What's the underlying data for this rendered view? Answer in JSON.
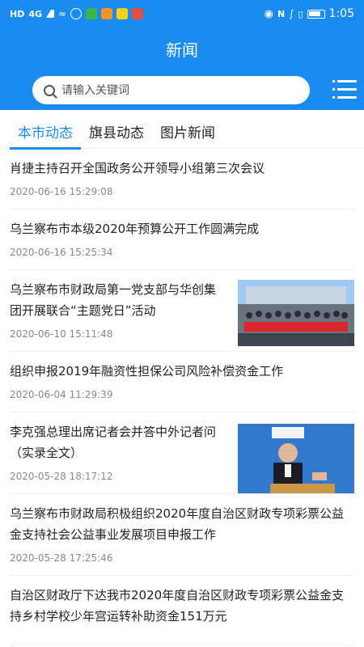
{
  "status_bar": {
    "left_label": "HD",
    "network": "4G",
    "time": "1:05"
  },
  "header": {
    "title": "新闻"
  },
  "search": {
    "placeholder": "请输入关键词"
  },
  "tabs": [
    {
      "label": "本市动态",
      "active": true
    },
    {
      "label": "旗县动态",
      "active": false
    },
    {
      "label": "图片新闻",
      "active": false
    }
  ],
  "news": [
    {
      "title": "肖捷主持召开全国政务公开领导小组第三次会议",
      "time": "2020-06-16 15:29:08",
      "thumb": null
    },
    {
      "title": "乌兰察布市本级2020年预算公开工作圆满完成",
      "time": "2020-06-16 15:25:34",
      "thumb": null
    },
    {
      "title": "乌兰察布市财政局第一党支部与华创集团开展联合“主题党日”活动",
      "time": "2020-06-10 15:11:48",
      "thumb": "group-photo"
    },
    {
      "title": "组织申报2019年融资性担保公司风险补偿资金工作",
      "time": "2020-06-04 11:29:39",
      "thumb": null
    },
    {
      "title": "李克强总理出席记者会并答中外记者问（实录全文）",
      "time": "2020-05-28 18:17:12",
      "thumb": "press-conference-photo"
    },
    {
      "title": "乌兰察布市财政局积极组织2020年度自治区财政专项彩票公益金支持社会公益事业发展项目申报工作",
      "time": "2020-05-28 17:25:46",
      "thumb": null
    },
    {
      "title": "自治区财政厅下达我市2020年度自治区财政专项彩票公益金支持乡村学校少年宫运转补助资金151万元",
      "time": "",
      "thumb": null
    }
  ],
  "colors": {
    "brand": "#1a8cf0",
    "text": "#222222",
    "meta": "#888888"
  }
}
